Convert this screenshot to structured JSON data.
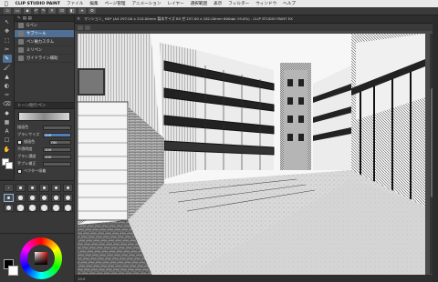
{
  "menubar": {
    "apple": "",
    "items": [
      "CLIP STUDIO PAINT",
      "ファイル",
      "編集",
      "ページ管理",
      "アニメーション",
      "レイヤー",
      "選択範囲",
      "表示",
      "フィルター",
      "ウィンドウ",
      "ヘルプ"
    ]
  },
  "document": {
    "tab_title": "マンション_ HD* (A4 297.00 x 210.00mm 製本サイズ B5 판 257.00 x 182.00mm 600dpi 19.0%) - CLIP STUDIO PAINT EX",
    "app_label": "- CLIP STUDIO PAINT EX"
  },
  "tools": {
    "items": [
      "↖",
      "✥",
      "⬚",
      "✂",
      "✎",
      "🖌",
      "▲",
      "◐",
      "✑",
      "⌫",
      "◆",
      "▦",
      "A",
      "☐",
      "✋"
    ]
  },
  "subtool": {
    "items": [
      {
        "label": "Gペン",
        "selected": false
      },
      {
        "label": "サブツール",
        "selected": true
      },
      {
        "label": "ペン軸カスタム",
        "selected": false
      },
      {
        "label": "ミリペン",
        "selected": false
      },
      {
        "label": "ガイドライン補助",
        "selected": false
      }
    ]
  },
  "toolprop": {
    "name": "トーン削りペン",
    "rows": [
      {
        "label": "描画色",
        "value": ""
      },
      {
        "label": "ブラシサイズ",
        "value": "100"
      },
      {
        "label": "描画色",
        "value": "ON"
      },
      {
        "label": "不透明度",
        "value": "100"
      },
      {
        "label": "ブラシ濃度",
        "value": "100"
      },
      {
        "label": "手ブレ補正",
        "value": ""
      },
      {
        "label": "ベクター吸着",
        "value": ""
      }
    ]
  },
  "brushsize": {
    "sizes": [
      1,
      1.5,
      2,
      2.5,
      3,
      3.5,
      4,
      4.5,
      5,
      5.5,
      6,
      6.5,
      7,
      7.5,
      8,
      8.5,
      9,
      9.5
    ],
    "selected_index": 6
  },
  "colors": {
    "main": "#000000",
    "sub": "#ffffff",
    "accent": "#4f6f94"
  },
  "status": {
    "zoom": "19.0"
  }
}
